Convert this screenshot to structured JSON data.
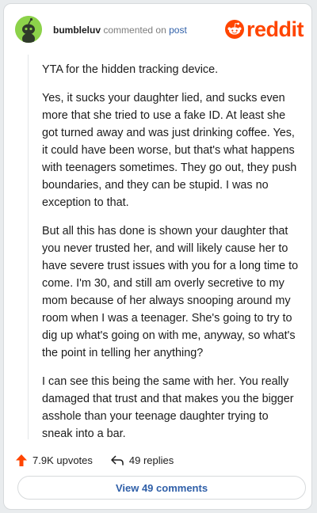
{
  "comment": {
    "username": "bumbleluv",
    "commented_on_text": "commented on",
    "post_link": "post",
    "paragraphs": [
      "YTA for the hidden tracking device.",
      "Yes, it sucks your daughter lied, and sucks even more that she tried to use a fake ID. At least she got turned away and was just drinking coffee. Yes, it could have been worse, but that's what happens with teenagers sometimes. They go out, they push boundaries, and they can be stupid. I was no exception to that.",
      "But all this has done is shown your daughter that you never trusted her, and will likely cause her to have severe trust issues with you for a long time to come. I'm 30, and still am overly secretive to my mom because of her always snooping around my room when I was a teenager. She's going to try to dig up what's going on with me, anyway, so what's the point in telling her anything?",
      "I can see this being the same with her. You really damaged that trust and that makes you the bigger asshole than your teenage daughter trying to sneak into a bar."
    ],
    "upvotes": "7.9K upvotes",
    "replies": "49 replies",
    "view_comments": "View 49 comments"
  },
  "brand": {
    "name": "reddit",
    "color": "#ff4500"
  },
  "colors": {
    "avatar": "#8cd24a",
    "link": "#2f5fa8",
    "upvote": "#ff4500"
  },
  "icons": [
    "avatar-icon",
    "reddit-logo-icon",
    "upvote-arrow-icon",
    "reply-arrow-icon"
  ]
}
